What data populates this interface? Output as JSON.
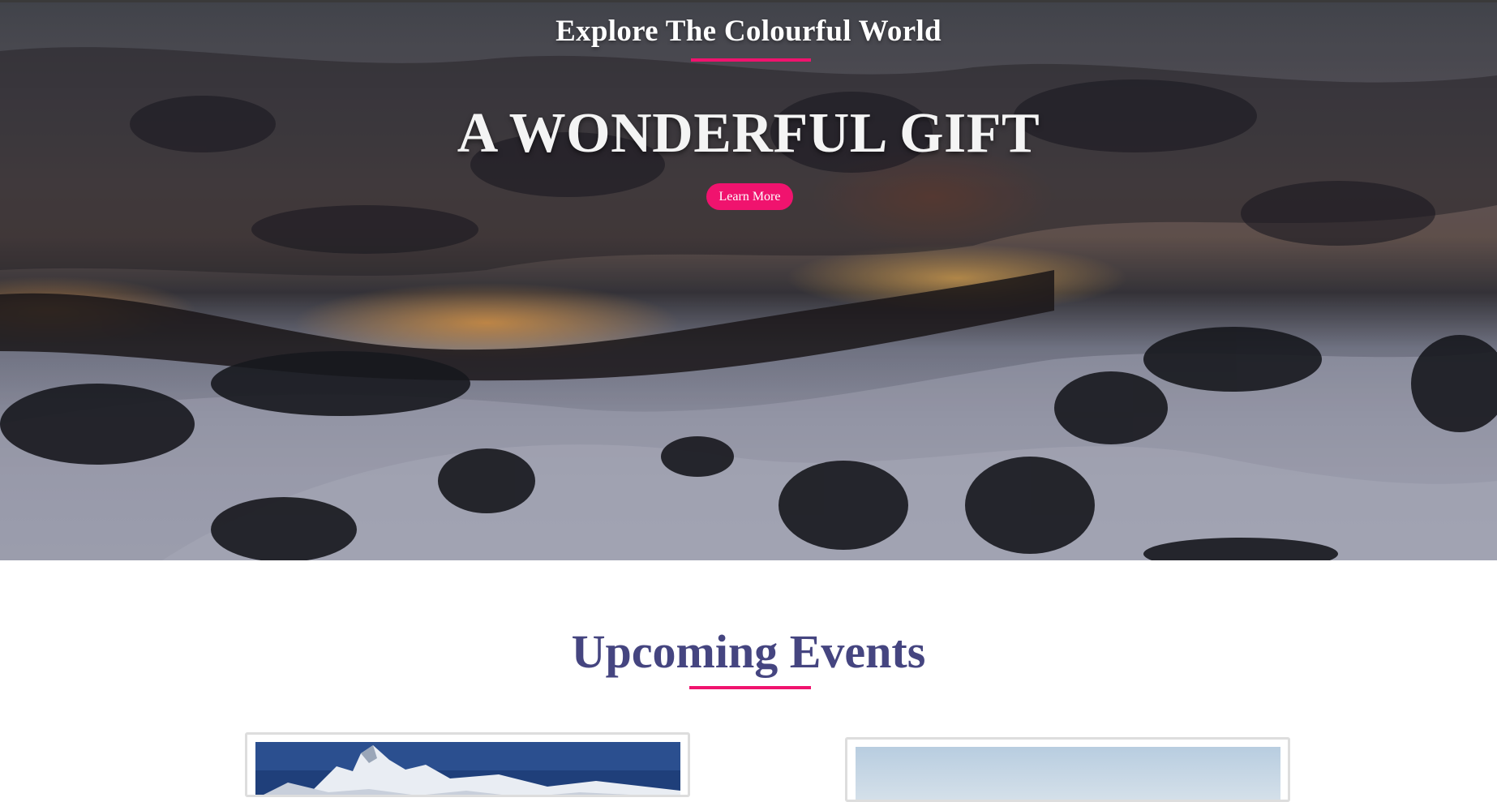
{
  "hero": {
    "subtitle": "Explore The Colourful World",
    "title": "A WONDERFUL GIFT",
    "button_label": "Learn More",
    "accent_color": "#f0136e",
    "background_image": "snowy-mountain-valley-at-dusk"
  },
  "events": {
    "heading": "Upcoming Events",
    "heading_color": "#454580",
    "cards": [
      {
        "image": "snowy-mountain-peak-photo"
      },
      {
        "image": "pale-sky-landscape-photo"
      }
    ]
  }
}
